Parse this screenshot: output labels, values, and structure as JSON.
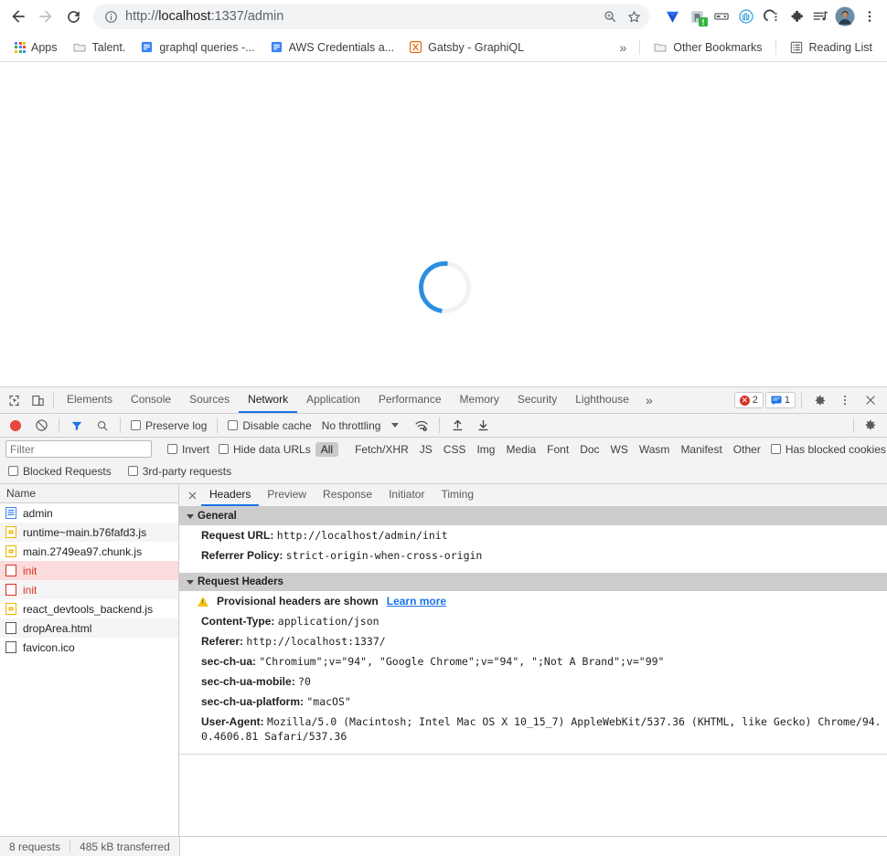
{
  "browser": {
    "nav": {
      "back": "back-arrow",
      "forward": "forward-arrow",
      "reload": "reload"
    },
    "omnibox": {
      "url_scheme": "http://",
      "url_host": "localhost",
      "url_rest": ":1337/admin",
      "full_url": "http://localhost:1337/admin",
      "site_info_icon": "site-information-icon",
      "zoom_icon": "zoom-search-icon",
      "bookmark_icon": "star-icon"
    },
    "extensions": [
      {
        "name": "yandex-extension-icon"
      },
      {
        "name": "postman-interceptor-icon"
      },
      {
        "name": "capture-extension-icon"
      },
      {
        "name": "pocket-extension-icon"
      },
      {
        "name": "clickup-extension-icon"
      },
      {
        "name": "puzzle-extensions-icon"
      },
      {
        "name": "playlist-extension-icon"
      }
    ],
    "profile": {
      "name": "profile-avatar"
    },
    "menu": {
      "name": "chrome-menu-icon"
    },
    "bookmarks": {
      "items": [
        {
          "label": "Apps",
          "icon": "apps-grid-icon"
        },
        {
          "label": "Talent.",
          "icon": "folder-icon"
        },
        {
          "label": "graphql queries -...",
          "icon": "doc-icon"
        },
        {
          "label": "AWS Credentials a...",
          "icon": "doc-icon"
        },
        {
          "label": "Gatsby - GraphiQL",
          "icon": "graphiql-icon"
        }
      ],
      "overflow": "»",
      "other_bookmarks": "Other Bookmarks",
      "reading_list": "Reading List"
    }
  },
  "page": {
    "spinner": "loading-spinner",
    "spinner_color": "#2b8fe0"
  },
  "devtools": {
    "panel_tabs": [
      {
        "label": "Elements",
        "active": false
      },
      {
        "label": "Console",
        "active": false
      },
      {
        "label": "Sources",
        "active": false
      },
      {
        "label": "Network",
        "active": true
      },
      {
        "label": "Application",
        "active": false
      },
      {
        "label": "Performance",
        "active": false
      },
      {
        "label": "Memory",
        "active": false
      },
      {
        "label": "Security",
        "active": false
      },
      {
        "label": "Lighthouse",
        "active": false
      }
    ],
    "tabs_overflow": "»",
    "errors_count": "2",
    "messages_count": "1",
    "toolbar": {
      "record_title": "record-button",
      "clear_title": "clear-button",
      "filter_title": "filter-button",
      "search_title": "search-button",
      "preserve_log": "Preserve log",
      "disable_cache": "Disable cache",
      "throttling": "No throttling",
      "import_har": "import-har-button",
      "export_har": "export-har-button",
      "network_conditions": "network-conditions-icon",
      "settings": "settings-gear-icon",
      "more": "more-options-icon",
      "close": "close-devtools-icon"
    },
    "filterbar": {
      "filter_placeholder": "Filter",
      "filter_value": "",
      "invert": "Invert",
      "hide_data_urls": "Hide data URLs",
      "types": [
        "All",
        "Fetch/XHR",
        "JS",
        "CSS",
        "Img",
        "Media",
        "Font",
        "Doc",
        "WS",
        "Wasm",
        "Manifest",
        "Other"
      ],
      "active_type": "All",
      "has_blocked_cookies": "Has blocked cookies",
      "blocked_requests": "Blocked Requests",
      "third_party_requests": "3rd-party requests"
    },
    "requests": {
      "column_header": "Name",
      "rows": [
        {
          "name": "admin",
          "icon": "document-icon",
          "state": "normal"
        },
        {
          "name": "runtime~main.b76fafd3.js",
          "icon": "script-icon",
          "state": "alt"
        },
        {
          "name": "main.2749ea97.chunk.js",
          "icon": "script-icon",
          "state": "normal"
        },
        {
          "name": "init",
          "icon": "failed-icon",
          "state": "selected-error"
        },
        {
          "name": "init",
          "icon": "failed-icon",
          "state": "error"
        },
        {
          "name": "react_devtools_backend.js",
          "icon": "script-icon",
          "state": "normal"
        },
        {
          "name": "dropArea.html",
          "icon": "other-icon",
          "state": "alt"
        },
        {
          "name": "favicon.ico",
          "icon": "other-icon",
          "state": "normal"
        }
      ]
    },
    "detail": {
      "close": "close-detail-icon",
      "tabs": [
        {
          "label": "Headers",
          "active": true
        },
        {
          "label": "Preview",
          "active": false
        },
        {
          "label": "Response",
          "active": false
        },
        {
          "label": "Initiator",
          "active": false
        },
        {
          "label": "Timing",
          "active": false
        }
      ],
      "general": {
        "title": "General",
        "rows": [
          {
            "key": "Request URL:",
            "value": "http://localhost/admin/init"
          },
          {
            "key": "Referrer Policy:",
            "value": "strict-origin-when-cross-origin"
          }
        ]
      },
      "request_headers": {
        "title": "Request Headers",
        "provisional_text": "Provisional headers are shown",
        "learn_more": "Learn more",
        "warning_icon": "warning-triangle-icon",
        "rows": [
          {
            "key": "Content-Type:",
            "value": "application/json"
          },
          {
            "key": "Referer:",
            "value": "http://localhost:1337/"
          },
          {
            "key": "sec-ch-ua:",
            "value": "\"Chromium\";v=\"94\", \"Google Chrome\";v=\"94\", \";Not A Brand\";v=\"99\""
          },
          {
            "key": "sec-ch-ua-mobile:",
            "value": "?0"
          },
          {
            "key": "sec-ch-ua-platform:",
            "value": "\"macOS\""
          },
          {
            "key": "User-Agent:",
            "value": "Mozilla/5.0 (Macintosh; Intel Mac OS X 10_15_7) AppleWebKit/537.36 (KHTML, like Gecko) Chrome/94.0.4606.81 Safari/537.36"
          }
        ]
      }
    },
    "status": {
      "requests": "8 requests",
      "transferred": "485 kB transferred"
    }
  }
}
